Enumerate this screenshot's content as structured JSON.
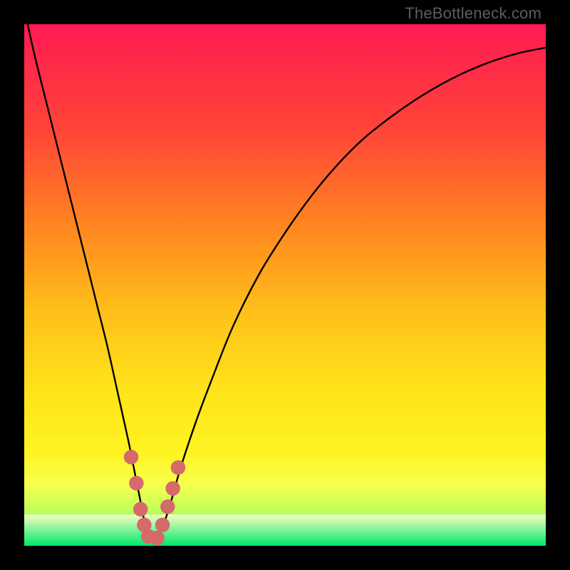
{
  "watermark": "TheBottleneck.com",
  "chart_data": {
    "type": "line",
    "title": "",
    "xlabel": "",
    "ylabel": "",
    "xlim": [
      0,
      100
    ],
    "ylim": [
      0,
      100
    ],
    "grid": false,
    "series": [
      {
        "name": "bottleneck-curve",
        "x": [
          0,
          2,
          4,
          6,
          8,
          10,
          12,
          14,
          16,
          18,
          20,
          21,
          22,
          23,
          24,
          25,
          26,
          28,
          30,
          33,
          36,
          40,
          45,
          50,
          55,
          60,
          65,
          70,
          75,
          80,
          85,
          90,
          95,
          100
        ],
        "y": [
          103,
          94,
          86,
          78,
          70,
          62,
          54,
          46,
          38,
          29,
          20,
          15,
          10,
          5,
          2,
          0.5,
          2,
          8,
          15,
          24,
          32,
          42,
          52,
          60,
          67,
          73,
          78,
          82,
          85.5,
          88.5,
          91,
          93,
          94.5,
          95.5
        ]
      }
    ],
    "markers": {
      "name": "highlight-dots",
      "color": "#d46a6a",
      "radius_pct": 1.4,
      "points": [
        {
          "x": 20.5,
          "y": 17
        },
        {
          "x": 21.5,
          "y": 12
        },
        {
          "x": 22.3,
          "y": 7
        },
        {
          "x": 23.0,
          "y": 4
        },
        {
          "x": 23.8,
          "y": 1.8
        },
        {
          "x": 25.5,
          "y": 1.5
        },
        {
          "x": 26.5,
          "y": 4
        },
        {
          "x": 27.5,
          "y": 7.5
        },
        {
          "x": 28.5,
          "y": 11
        },
        {
          "x": 29.5,
          "y": 15
        }
      ]
    },
    "background_gradient": {
      "stops": [
        {
          "y": 100,
          "color": "#ff1a53"
        },
        {
          "y": 80,
          "color": "#ff4438"
        },
        {
          "y": 60,
          "color": "#ff8a1f"
        },
        {
          "y": 45,
          "color": "#ffbf1a"
        },
        {
          "y": 30,
          "color": "#ffe31a"
        },
        {
          "y": 18,
          "color": "#fff320"
        },
        {
          "y": 12,
          "color": "#f8ff4d"
        },
        {
          "y": 7,
          "color": "#c3ff5a"
        },
        {
          "y": 3,
          "color": "#5dff70"
        },
        {
          "y": 0,
          "color": "#00e86c"
        }
      ]
    },
    "bottom_band": {
      "y_top": 6,
      "color_top": "#f6ffc0",
      "color_bottom": "#00e86c"
    }
  }
}
